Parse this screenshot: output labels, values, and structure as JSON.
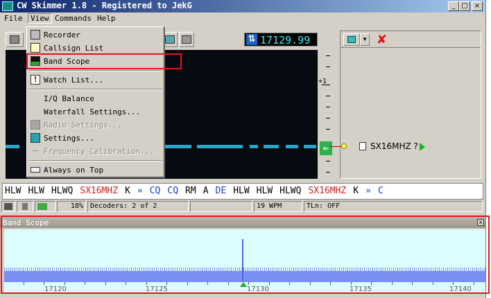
{
  "window": {
    "title": "CW Skimmer 1.8 - Registered to JekG",
    "min": "_",
    "max": "□",
    "close": "×"
  },
  "menubar": {
    "file": "File",
    "view": "View",
    "commands": "Commands",
    "help": "Help"
  },
  "toolbar": {
    "frequency": "17129.99",
    "rx_arrow": "⇅"
  },
  "scale": {
    "label": "+1"
  },
  "spot": {
    "callsign": "SX16MHZ ?"
  },
  "decode": {
    "tokens": [
      {
        "t": "HLW",
        "c": "w"
      },
      {
        "t": "HLW",
        "c": "w"
      },
      {
        "t": "HLWQ",
        "c": "w"
      },
      {
        "t": "SX16MHZ",
        "c": "r"
      },
      {
        "t": "K",
        "c": "w"
      },
      {
        "t": "»",
        "c": "b"
      },
      {
        "t": "CQ",
        "c": "b"
      },
      {
        "t": "CQ",
        "c": "b"
      },
      {
        "t": "RM",
        "c": "w"
      },
      {
        "t": "A",
        "c": "w"
      },
      {
        "t": "DE",
        "c": "b"
      },
      {
        "t": "HLW",
        "c": "w"
      },
      {
        "t": "HLW",
        "c": "w"
      },
      {
        "t": "HLWQ",
        "c": "w"
      },
      {
        "t": "SX16MHZ",
        "c": "r"
      },
      {
        "t": "K",
        "c": "w"
      },
      {
        "t": "»",
        "c": "b"
      },
      {
        "t": "C",
        "c": "b"
      }
    ]
  },
  "status": {
    "cpu": "18%",
    "decoders": "Decoders: 2 of 2",
    "wpm": "19 WPM",
    "tln": "TLn: OFF"
  },
  "bandscope": {
    "title": "Band Scope",
    "axis_labels": [
      "17120",
      "17125",
      "17130",
      "17135",
      "17140"
    ]
  },
  "view_menu": {
    "items": [
      {
        "label": "Recorder",
        "icon": "recorder-icon",
        "enabled": true
      },
      {
        "label": "Callsign List",
        "icon": "list-icon",
        "enabled": true
      },
      {
        "label": "Band Scope",
        "icon": "bandscope-icon",
        "enabled": true
      },
      {
        "label": "Watch List...",
        "icon": "watch-icon",
        "enabled": true
      },
      {
        "label": "I/Q Balance",
        "icon": "",
        "enabled": true
      },
      {
        "label": "Waterfall Settings...",
        "icon": "",
        "enabled": true
      },
      {
        "label": "Radio Settings...",
        "icon": "radio-icon",
        "enabled": false
      },
      {
        "label": "Settings...",
        "icon": "settings-icon",
        "enabled": true
      },
      {
        "label": "Frequency Calibration...",
        "icon": "",
        "enabled": false
      },
      {
        "label": "Always on Top",
        "icon": "pin-icon",
        "enabled": true
      }
    ]
  },
  "colors": {
    "accent_red": "#e0161b",
    "freq_cyan": "#2ef0f0",
    "trace": "#27a7c8"
  }
}
